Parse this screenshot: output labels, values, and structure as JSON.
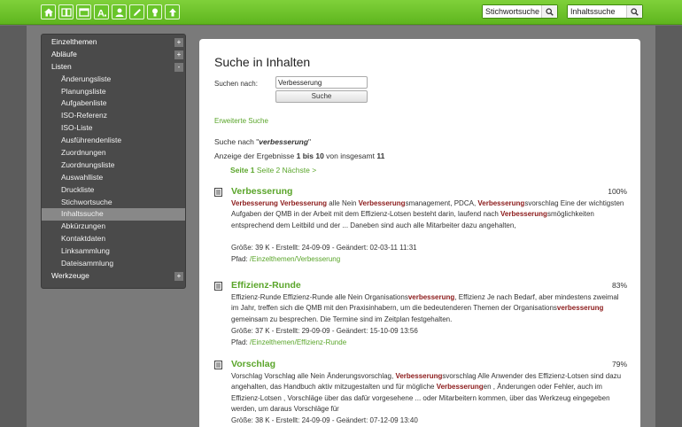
{
  "toolbar": {
    "buttons": [
      "home-icon",
      "book-icon",
      "window-icon",
      "font-icon",
      "user-icon",
      "pencil-icon",
      "lightbulb-icon",
      "upload-icon"
    ],
    "keyword_search_value": "Stichwortsuche",
    "content_search_value": "Inhaltssuche"
  },
  "sidebar": {
    "items": [
      {
        "label": "Einzelthemen",
        "toggle": "+"
      },
      {
        "label": "Abläufe",
        "toggle": "+"
      },
      {
        "label": "Listen",
        "toggle": "-"
      },
      {
        "label": "Änderungsliste"
      },
      {
        "label": "Planungsliste"
      },
      {
        "label": "Aufgabenliste"
      },
      {
        "label": "ISO-Referenz"
      },
      {
        "label": "ISO-Liste"
      },
      {
        "label": "Ausführendenliste"
      },
      {
        "label": "Zuordnungen"
      },
      {
        "label": "Zuordnungsliste"
      },
      {
        "label": "Auswahlliste"
      },
      {
        "label": "Druckliste"
      },
      {
        "label": "Stichwortsuche"
      },
      {
        "label": "Inhaltssuche"
      },
      {
        "label": "Abkürzungen"
      },
      {
        "label": "Kontaktdaten"
      },
      {
        "label": "Linksammlung"
      },
      {
        "label": "Dateisammlung"
      },
      {
        "label": "Werkzeuge",
        "toggle": "+"
      }
    ]
  },
  "main": {
    "title": "Suche in Inhalten",
    "search_label": "Suchen nach:",
    "query_value": "Verbesserung",
    "search_button": "Suche",
    "advanced_link": "Erweiterte Suche",
    "search_for_prefix": "Suche nach \"",
    "search_for_term": "verbesserung",
    "search_for_suffix": "\"",
    "count_prefix": "Anzeige der Ergebnisse ",
    "count_range": "1 bis 10",
    "count_mid": " von insgesamt ",
    "count_total": "11",
    "pager_page_label": "Seite",
    "pager_current": "1",
    "pager_next_page": "Seite 2",
    "pager_next": "Nächste >"
  },
  "results": [
    {
      "title": "Verbesserung",
      "score": "100%",
      "text_parts": [
        {
          "t": "Verbesserung",
          "h": true
        },
        {
          "t": " "
        },
        {
          "t": "Verbesserung",
          "h": true
        },
        {
          "t": " alle Nein "
        },
        {
          "t": "Verbesserung",
          "h": true
        },
        {
          "t": "smanagement, PDCA, "
        },
        {
          "t": "Verbesserung",
          "h": true
        },
        {
          "t": "svorschlag Eine der wichtigsten Aufgaben der  QMB in der Arbeit mit dem  Effizienz-Lotsen besteht darin, laufend nach "
        },
        {
          "t": "Verbesserung",
          "h": true
        },
        {
          "t": "smöglichkeiten entsprechend dem  Leitbild  und der ... Daneben sind auch alle Mitarbeiter dazu angehalten,"
        }
      ],
      "meta": "Größe: 39 K - Erstellt: 24-09-09 - Geändert: 02-03-11 11:31",
      "path_label": "Pfad: ",
      "path": "/Einzelthemen/Verbesserung"
    },
    {
      "title": "Effizienz-Runde",
      "score": "83%",
      "text_parts": [
        {
          "t": "Effizienz-Runde Effizienz-Runde alle Nein Organisations"
        },
        {
          "t": "verbesserung",
          "h": true
        },
        {
          "t": ", Effizienz Je nach Bedarf, aber mindestens zweimal im Jahr, treffen sich die  QMB mit den Praxisinhabern, um die bedeutenderen Themen der Organisations"
        },
        {
          "t": "verbesserung",
          "h": true
        },
        {
          "t": " gemeinsam zu besprechen. Die Termine sind im Zeitplan festgehalten."
        }
      ],
      "meta": "Größe: 37 K - Erstellt: 29-09-09 - Geändert: 15-10-09 13:56",
      "path_label": "Pfad: ",
      "path": "/Einzelthemen/Effizienz-Runde"
    },
    {
      "title": "Vorschlag",
      "score": "79%",
      "text_parts": [
        {
          "t": "Vorschlag Vorschlag alle Nein Änderungsvorschlag, "
        },
        {
          "t": "Verbesserung",
          "h": true
        },
        {
          "t": "svorschlag Alle Anwender des  Effizienz-Lotsen sind dazu angehalten, das Handbuch aktiv mitzugestalten und für mögliche  "
        },
        {
          "t": "Verbesserung",
          "h": true
        },
        {
          "t": "en , Änderungen oder Fehler, auch im  Effizienz-Lotsen , Vorschläge über das dafür vorgesehene ... oder Mitarbeitern kommen, über das Werkzeug eingegeben werden, um daraus Vorschläge für"
        }
      ],
      "meta": "Größe: 38 K - Erstellt: 24-09-09 - Geändert: 07-12-09 13:40"
    }
  ]
}
